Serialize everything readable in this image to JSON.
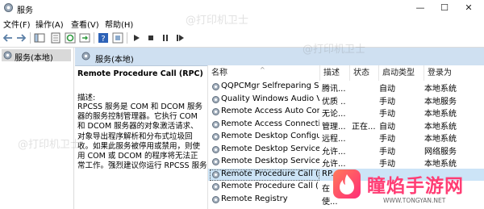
{
  "window": {
    "title": "服务",
    "minimize": "—",
    "maximize": "☐",
    "close": "✕"
  },
  "menu": {
    "file": "文件(F)",
    "action": "操作(A)",
    "view": "查看(V)",
    "help": "帮助(H)"
  },
  "toolbar": {
    "icons": [
      "back-icon",
      "forward-icon",
      "console-tree-icon",
      "properties-icon",
      "refresh-icon",
      "export-icon",
      "help-icon",
      "info-icon",
      "play-icon",
      "stop-icon",
      "pause-icon",
      "restart-icon"
    ]
  },
  "tree": {
    "root": "服务(本地)"
  },
  "pane": {
    "header": "服务(本地)"
  },
  "detail": {
    "title": "Remote Procedure Call (RPC)",
    "desc_label": "描述:",
    "desc_lines": [
      "RPCSS 服务是 COM 和 DCOM 服务",
      "器的服务控制管理器。它执行 COM",
      "和 DCOM 服务器的对象激活请求、",
      "对象导出程序解析和分布式垃圾回",
      "收。如果此服务被停用或禁用，则使",
      "用 COM 或 DCOM 的程序将无法正",
      "常工作。强烈建议你运行 RPCSS 服务。"
    ]
  },
  "columns": {
    "name": "名称",
    "desc": "描述",
    "status": "状态",
    "startup": "启动类型",
    "logon": "登录为"
  },
  "services": [
    {
      "name": "QQPCMgr Selfreparing S...",
      "desc": "腾讯...",
      "status": "",
      "startup": "自动",
      "logon": "本地系统"
    },
    {
      "name": "Quality Windows Audio V...",
      "desc": "优质 ...",
      "status": "",
      "startup": "手动",
      "logon": "本地服务"
    },
    {
      "name": "Remote Access Auto Con...",
      "desc": "无论...",
      "status": "",
      "startup": "手动",
      "logon": "本地系统"
    },
    {
      "name": "Remote Access Connecti...",
      "desc": "管理...",
      "status": "正在...",
      "startup": "自动",
      "logon": "本地系统"
    },
    {
      "name": "Remote Desktop Configu...",
      "desc": "远程...",
      "status": "",
      "startup": "手动",
      "logon": "本地系统"
    },
    {
      "name": "Remote Desktop Services",
      "desc": "允许...",
      "status": "",
      "startup": "手动",
      "logon": "网络服务"
    },
    {
      "name": "Remote Desktop Service...",
      "desc": "允许...",
      "status": "",
      "startup": "手动",
      "logon": "本地系统"
    },
    {
      "name": "Remote Procedure Call (...",
      "desc": "RP...",
      "status": "",
      "startup": "",
      "logon": ""
    },
    {
      "name": "Remote Procedure Call (...",
      "desc": "在 ...",
      "status": "",
      "startup": "",
      "logon": ""
    },
    {
      "name": "Remote Registry",
      "desc": "使...",
      "status": "",
      "startup": "",
      "logon": ""
    }
  ],
  "selected_index": 7,
  "watermark": "@打印机卫士",
  "brand": {
    "name": "瞳焰手游网",
    "url": "WWW.TONGYAN.NET",
    "color": "#ff3d74"
  }
}
